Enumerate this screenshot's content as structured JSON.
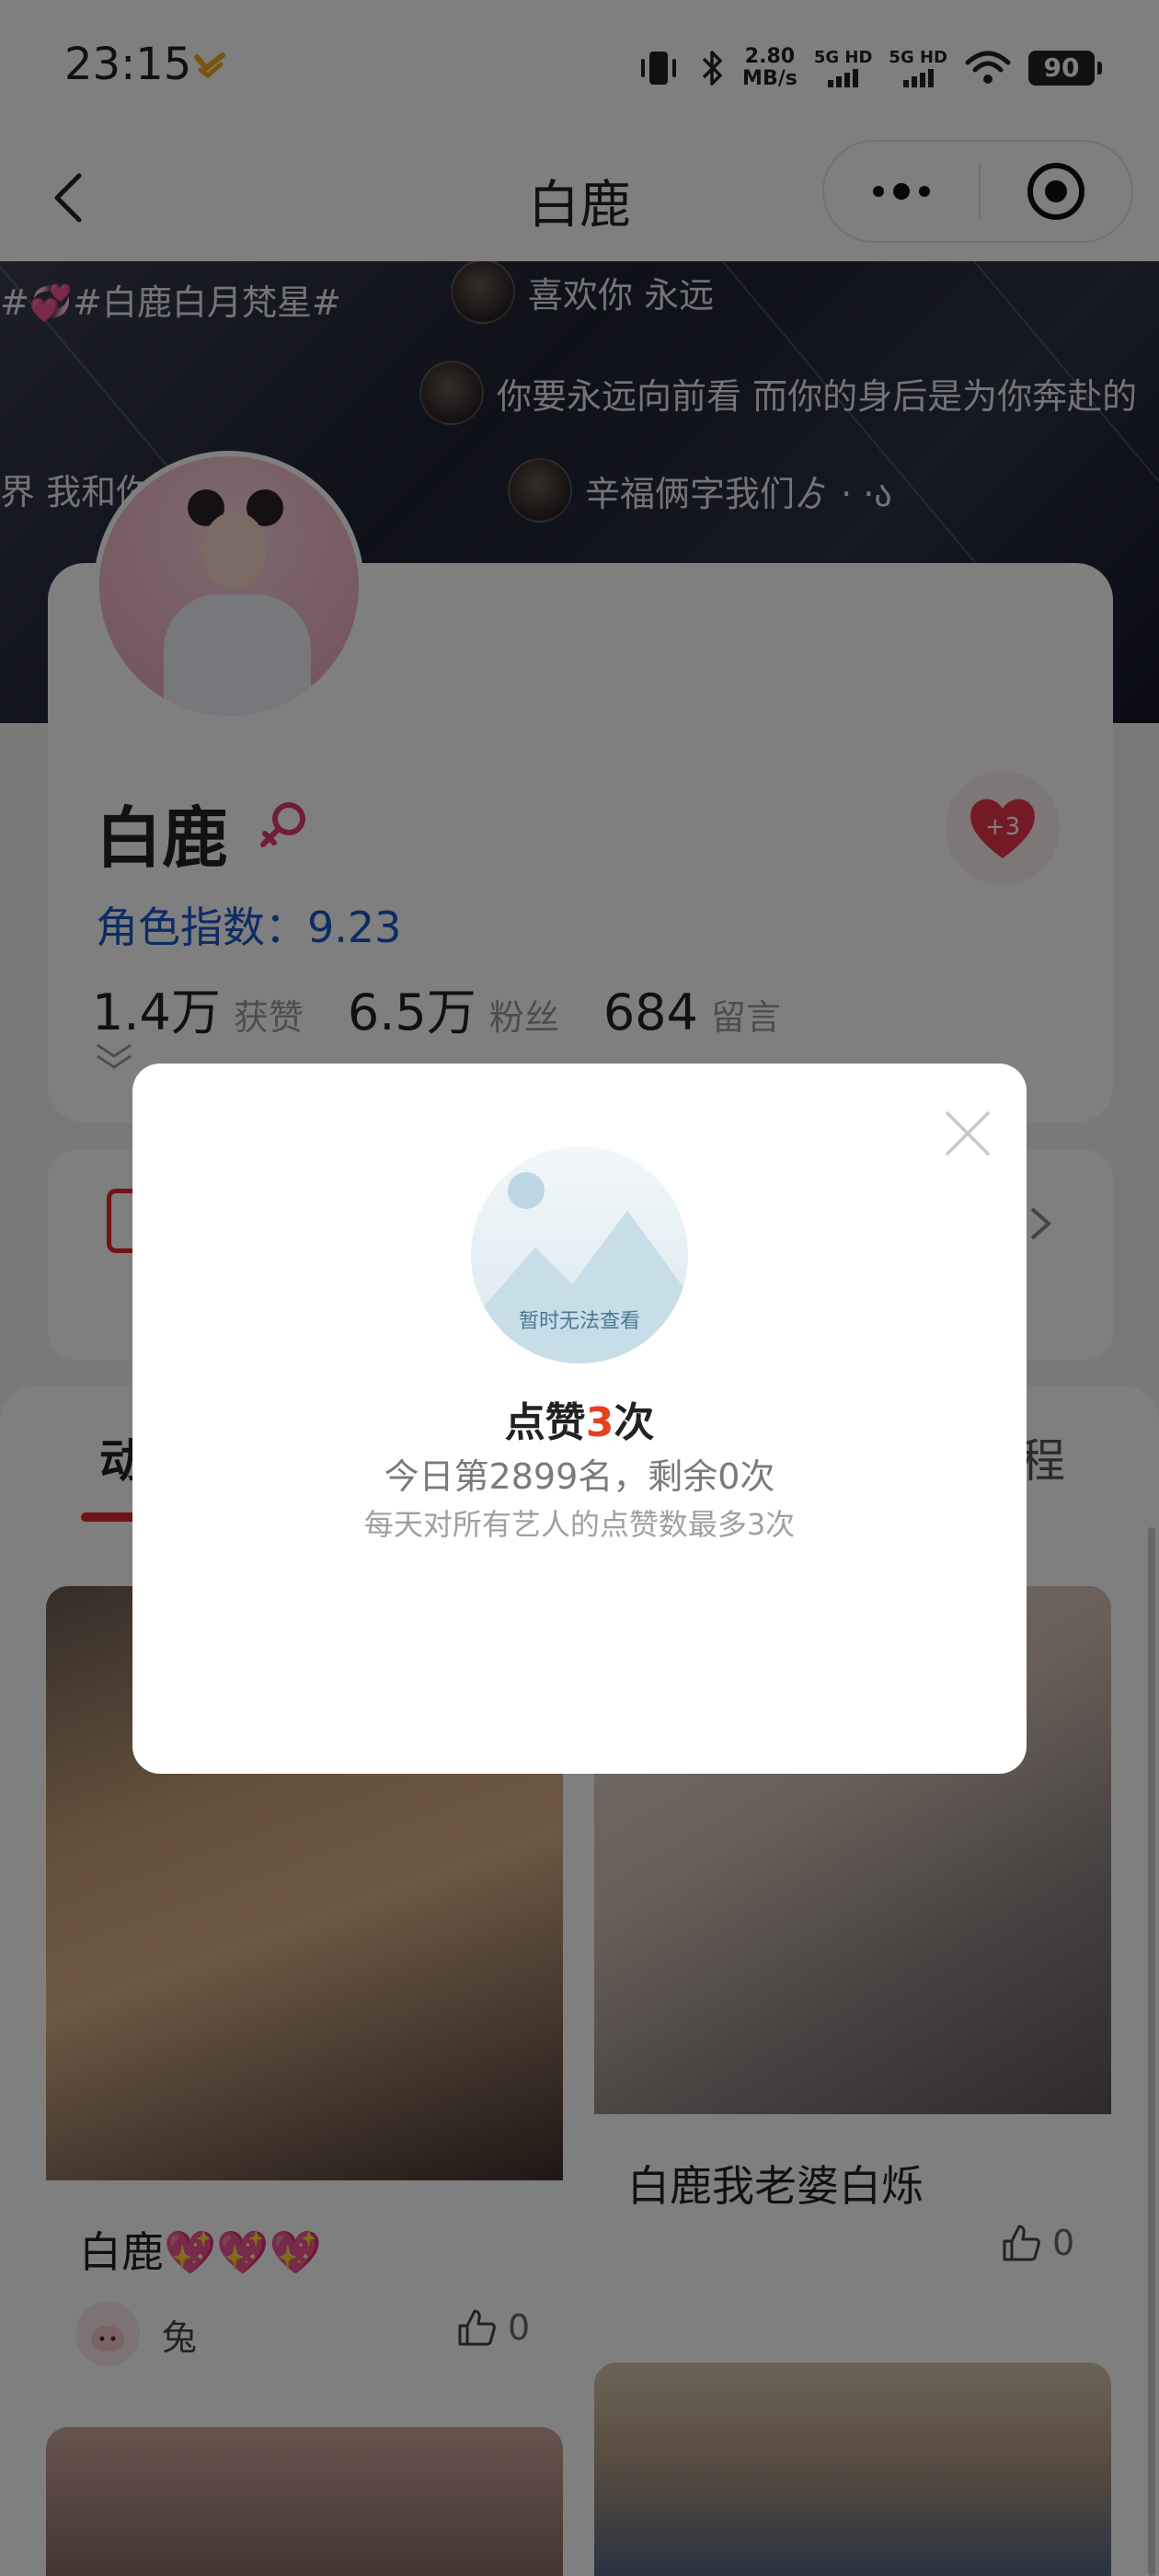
{
  "status_bar": {
    "time": "23:15",
    "net_speed_value": "2.80",
    "net_speed_unit": "MB/s",
    "sim1_label": "5G HD",
    "sim2_label": "5G HD",
    "battery": "90"
  },
  "nav": {
    "title": "白鹿"
  },
  "banner": {
    "hashtag": "#💞#白鹿白月梵星#",
    "comments": [
      "喜欢你 永远",
      "你要永远向前看 而你的身后是为你奔赴的",
      "辛福俩字我们ゟ  ·     ·ა"
    ],
    "left_fragment": "界 我和你"
  },
  "profile": {
    "name": "白鹿",
    "heart_badge": "+3",
    "index_label": "角色指数：",
    "index_value": "9.23",
    "stats": [
      {
        "value": "1.4万",
        "label": "获赞"
      },
      {
        "value": "6.5万",
        "label": "粉丝"
      },
      {
        "value": "684",
        "label": "留言"
      }
    ]
  },
  "tabs": {
    "left_fragment": "动",
    "right_fragment": "程"
  },
  "feed": {
    "post1": {
      "title": "白鹿💖💖💖",
      "user": "兔",
      "likes": "0"
    },
    "post2": {
      "title": "白鹿我老婆白烁",
      "likes": "0"
    }
  },
  "modal": {
    "placeholder_text": "暂时无法查看",
    "title_prefix": "点赞",
    "title_count": "3",
    "title_suffix": "次",
    "rank_text": "今日第2899名，剩余0次",
    "limit_text": "每天对所有艺人的点赞数最多3次"
  },
  "colors": {
    "accent_red": "#e0292f",
    "index_blue": "#1a56c8",
    "highlight_orange": "#e8401c"
  }
}
